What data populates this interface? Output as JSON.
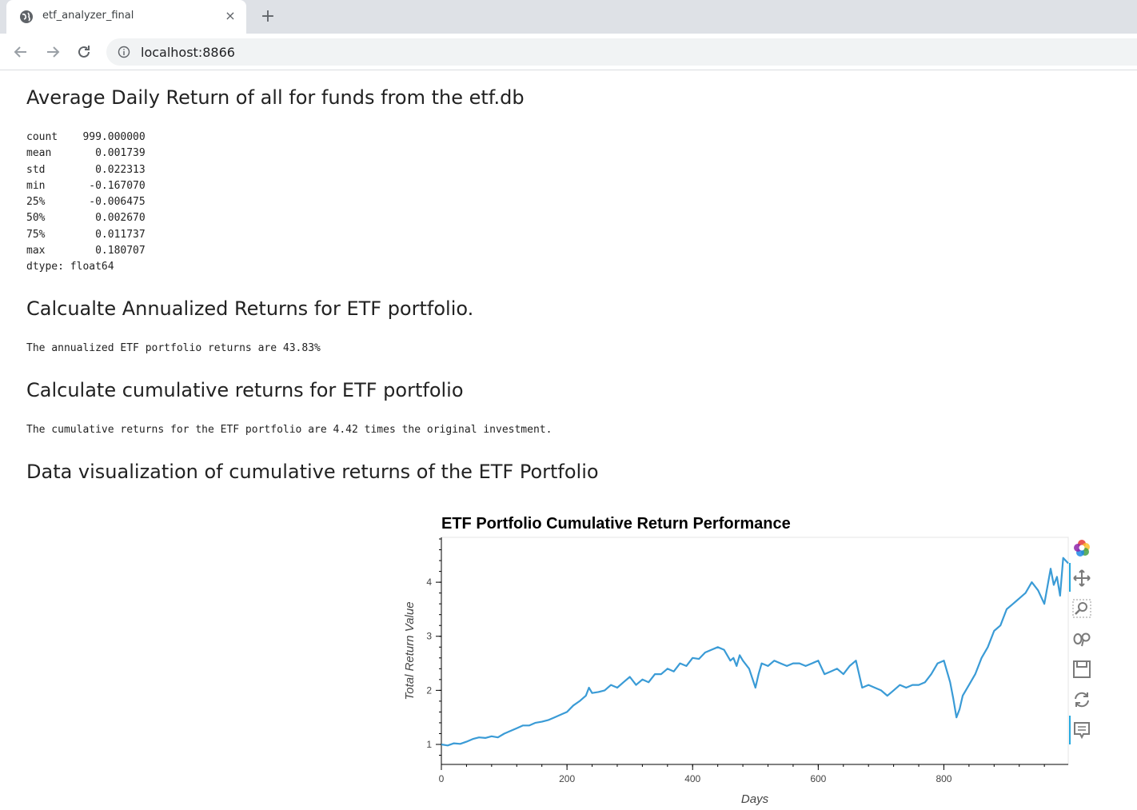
{
  "browser": {
    "tab_title": "etf_analyzer_final",
    "tab_close_label": "×",
    "new_tab_label": "+",
    "url": "localhost:8866"
  },
  "sections": [
    {
      "heading": "Average Daily Return of all for funds from the etf.db",
      "output": "count    999.000000\nmean       0.001739\nstd        0.022313\nmin       -0.167070\n25%       -0.006475\n50%        0.002670\n75%        0.011737\nmax        0.180707\ndtype: float64"
    },
    {
      "heading": "Calcualte Annualized Returns for ETF portfolio.",
      "output": "The annualized ETF portfolio returns are 43.83%"
    },
    {
      "heading": "Calculate cumulative returns for ETF portfolio",
      "output": "The cumulative returns for the ETF portfolio are 4.42 times the original investment."
    },
    {
      "heading": "Data visualization of cumulative returns of the ETF Portfolio"
    }
  ],
  "colors": {
    "line": "#3a9bd6",
    "heading": "#222222",
    "tab_bar": "#dee1e6",
    "omnibox": "#f1f3f4"
  },
  "chart_data": {
    "type": "line",
    "title": "ETF Portfolio Cumulative Return Performance",
    "xlabel": "Days",
    "ylabel": "Total Return Value",
    "xlim": [
      0,
      998
    ],
    "ylim": [
      0.63,
      4.83
    ],
    "xticks": [
      0,
      200,
      400,
      600,
      800
    ],
    "yticks": [
      1,
      2,
      3,
      4
    ],
    "series": [
      {
        "x": [
          0,
          10,
          20,
          30,
          40,
          50,
          60,
          70,
          80,
          90,
          100,
          110,
          120,
          130,
          140,
          150,
          160,
          170,
          180,
          190,
          200,
          210,
          220,
          230,
          235,
          240,
          250,
          260,
          270,
          280,
          290,
          300,
          310,
          320,
          330,
          340,
          350,
          360,
          370,
          380,
          390,
          400,
          410,
          420,
          430,
          440,
          450,
          460,
          465,
          470,
          475,
          480,
          490,
          500,
          505,
          510,
          520,
          530,
          540,
          550,
          560,
          570,
          580,
          590,
          600,
          610,
          620,
          630,
          640,
          650,
          660,
          670,
          680,
          690,
          700,
          710,
          720,
          730,
          740,
          750,
          760,
          770,
          780,
          790,
          800,
          805,
          810,
          815,
          820,
          825,
          830,
          840,
          850,
          860,
          870,
          880,
          890,
          900,
          910,
          920,
          930,
          940,
          950,
          960,
          970,
          975,
          980,
          985,
          990,
          998
        ],
        "y": [
          1.0,
          0.98,
          1.02,
          1.01,
          1.05,
          1.1,
          1.13,
          1.12,
          1.15,
          1.13,
          1.2,
          1.25,
          1.3,
          1.35,
          1.35,
          1.4,
          1.42,
          1.45,
          1.5,
          1.55,
          1.6,
          1.72,
          1.8,
          1.9,
          2.05,
          1.95,
          1.97,
          2.0,
          2.1,
          2.05,
          2.15,
          2.25,
          2.1,
          2.2,
          2.15,
          2.3,
          2.3,
          2.4,
          2.35,
          2.5,
          2.45,
          2.6,
          2.58,
          2.7,
          2.75,
          2.8,
          2.75,
          2.55,
          2.6,
          2.45,
          2.65,
          2.55,
          2.4,
          2.05,
          2.3,
          2.5,
          2.45,
          2.55,
          2.5,
          2.45,
          2.5,
          2.5,
          2.45,
          2.5,
          2.55,
          2.3,
          2.35,
          2.4,
          2.3,
          2.45,
          2.55,
          2.05,
          2.1,
          2.05,
          2.0,
          1.9,
          2.0,
          2.1,
          2.05,
          2.1,
          2.1,
          2.15,
          2.3,
          2.5,
          2.55,
          2.35,
          2.15,
          1.85,
          1.5,
          1.65,
          1.9,
          2.1,
          2.3,
          2.6,
          2.8,
          3.1,
          3.2,
          3.5,
          3.6,
          3.7,
          3.8,
          4.0,
          3.85,
          3.6,
          4.25,
          3.95,
          4.1,
          3.75,
          4.45,
          4.35
        ]
      }
    ]
  }
}
